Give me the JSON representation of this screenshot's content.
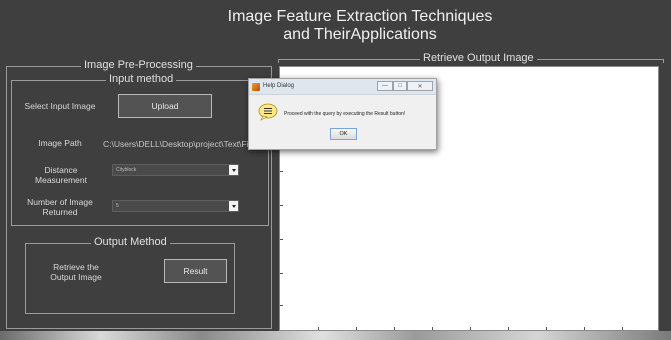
{
  "app": {
    "title_line1": "Image Feature Extraction Techniques",
    "title_line2": "and TheirApplications"
  },
  "preprocessing": {
    "title": "Image Pre-Processing",
    "input_method": {
      "title": "Input method",
      "select_image_label": "Select Input Image",
      "upload_label": "Upload",
      "path_label": "Image Path",
      "path_value": "C:\\Users\\DELL\\Desktop\\project\\Text\\Fi",
      "distance_label_line1": "Distance",
      "distance_label_line2": "Measurement",
      "distance_value": "Cityblock",
      "count_label_line1": "Number of Image",
      "count_label_line2": "Returned",
      "count_value": "5"
    }
  },
  "output_method": {
    "title": "Output Method",
    "retrieve_label_line1": "Retrieve the",
    "retrieve_label_line2": "Output Image",
    "result_label": "Result"
  },
  "output_panel": {
    "title": "Retrieve Output Image"
  },
  "help_dialog": {
    "title": "Help Dialog",
    "message": "Proceed with the query by executing the Result button!",
    "ok_label": "OK",
    "minimize_label": "—",
    "maximize_label": "□",
    "close_label": "✕"
  },
  "icons": {
    "app": "matlab-icon",
    "help": "help-speech-bubble-icon"
  }
}
